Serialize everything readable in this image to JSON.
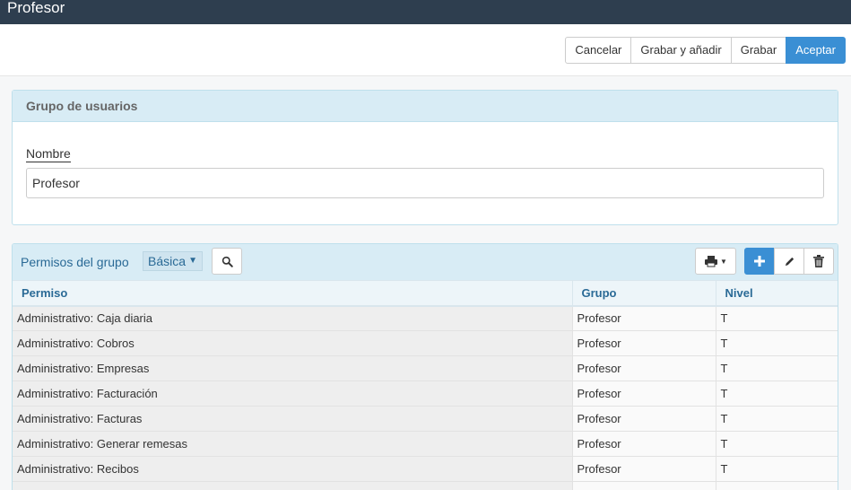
{
  "window": {
    "title": "Profesor"
  },
  "toolbar": {
    "cancel": "Cancelar",
    "save_add": "Grabar y añadir",
    "save": "Grabar",
    "accept": "Aceptar"
  },
  "group_panel": {
    "title": "Grupo de usuarios",
    "name_label": "Nombre",
    "name_value": "Profesor"
  },
  "permissions_panel": {
    "title": "Permisos del grupo",
    "filter_value": "Básica",
    "columns": [
      "Permiso",
      "Grupo",
      "Nivel"
    ],
    "rows": [
      [
        "Administrativo: Caja diaria",
        "Profesor",
        "T"
      ],
      [
        "Administrativo: Cobros",
        "Profesor",
        "T"
      ],
      [
        "Administrativo: Empresas",
        "Profesor",
        "T"
      ],
      [
        "Administrativo: Facturación",
        "Profesor",
        "T"
      ],
      [
        "Administrativo: Facturas",
        "Profesor",
        "T"
      ],
      [
        "Administrativo: Generar remesas",
        "Profesor",
        "T"
      ],
      [
        "Administrativo: Recibos",
        "Profesor",
        "T"
      ],
      [
        "",
        "",
        ""
      ]
    ]
  },
  "icons": {
    "search": "search-icon",
    "print": "print-icon",
    "add": "plus-icon",
    "edit": "pencil-icon",
    "delete": "trash-icon"
  },
  "colors": {
    "titlebar": "#2e3e4f",
    "primary": "#3a8fd4",
    "panel_header": "#d8ecf5",
    "header_text": "#2a6a96"
  }
}
